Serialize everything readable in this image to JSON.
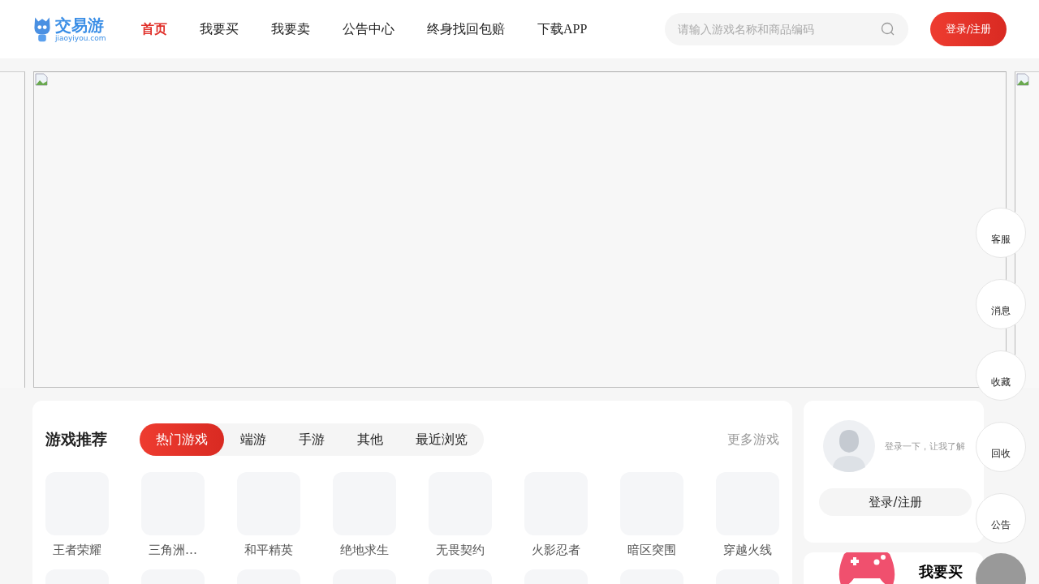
{
  "header": {
    "logo": {
      "name": "交易游",
      "domain": "jiaoyiyou.com"
    },
    "nav": [
      {
        "label": "首页",
        "selected": true
      },
      {
        "label": "我要买",
        "selected": false
      },
      {
        "label": "我要卖",
        "selected": false
      },
      {
        "label": "公告中心",
        "selected": false
      },
      {
        "label": "终身找回包赔",
        "selected": false
      },
      {
        "label": "下载APP",
        "selected": false
      }
    ],
    "search": {
      "placeholder": "请输入游戏名称和商品编码"
    },
    "login_button": "登录/注册"
  },
  "float_buttons": [
    "客服",
    "消息",
    "收藏",
    "回收",
    "公告"
  ],
  "games": {
    "title": "游戏推荐",
    "tabs": [
      {
        "label": "热门游戏",
        "selected": true
      },
      {
        "label": "端游",
        "selected": false
      },
      {
        "label": "手游",
        "selected": false
      },
      {
        "label": "其他",
        "selected": false
      },
      {
        "label": "最近浏览",
        "selected": false
      }
    ],
    "more": "更多游戏",
    "items": [
      "王者荣耀",
      "三角洲…",
      "和平精英",
      "绝地求生",
      "无畏契约",
      "火影忍者",
      "暗区突围",
      "穿越火线"
    ]
  },
  "user_card": {
    "hint": "登录一下，让我了解",
    "login_button": "登录/注册"
  },
  "buy_card": {
    "title": "我要买"
  }
}
